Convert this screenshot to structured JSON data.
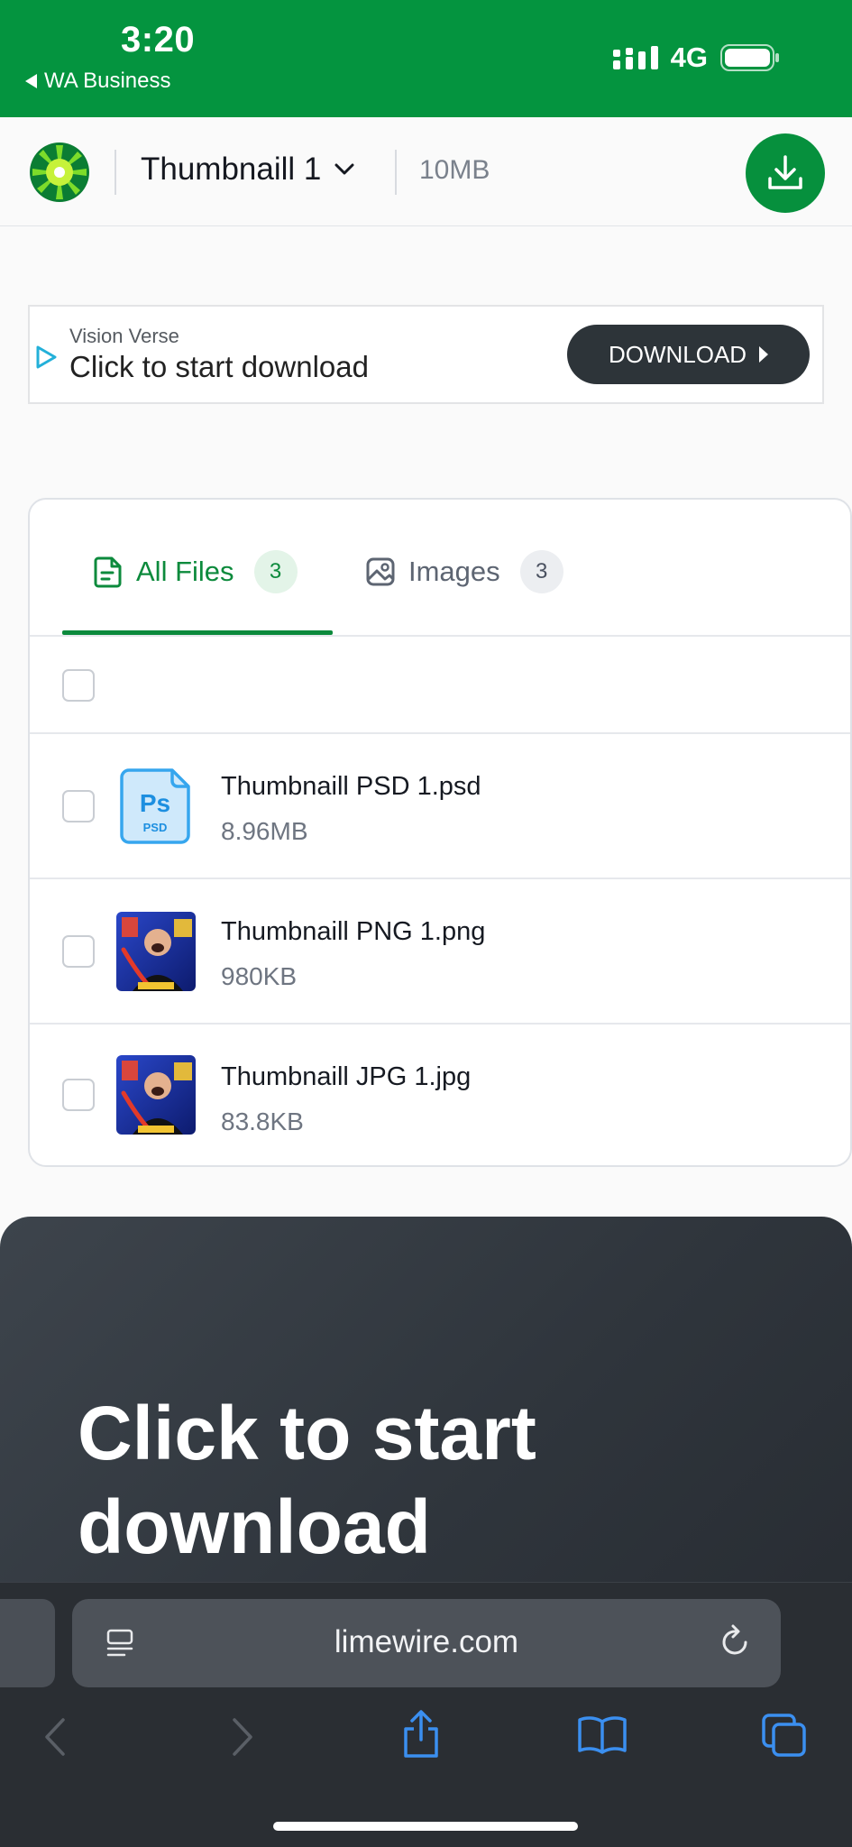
{
  "status_bar": {
    "time": "3:20",
    "back_app": "WA Business",
    "network": "4G"
  },
  "header": {
    "title": "Thumbnaill 1",
    "size": "10MB"
  },
  "ad": {
    "brand": "Vision Verse",
    "text": "Click to start download",
    "button": "DOWNLOAD"
  },
  "tabs": [
    {
      "label": "All Files",
      "count": "3"
    },
    {
      "label": "Images",
      "count": "3"
    }
  ],
  "files": [
    {
      "name": "Thumbnaill PSD 1.psd",
      "size": "8.96MB",
      "icon": "psd-file-icon"
    },
    {
      "name": "Thumbnaill PNG 1.png",
      "size": "980KB",
      "icon": "image-thumbnail"
    },
    {
      "name": "Thumbnaill JPG 1.jpg",
      "size": "83.8KB",
      "icon": "image-thumbnail"
    }
  ],
  "psd_icon": {
    "main": "Ps",
    "sub": "PSD"
  },
  "cta": {
    "text": "Click to start download"
  },
  "browser": {
    "url": "limewire.com"
  },
  "colors": {
    "brand_green": "#04943f",
    "accent_green": "#0c8a3c",
    "dark_panel": "#2f353c"
  }
}
